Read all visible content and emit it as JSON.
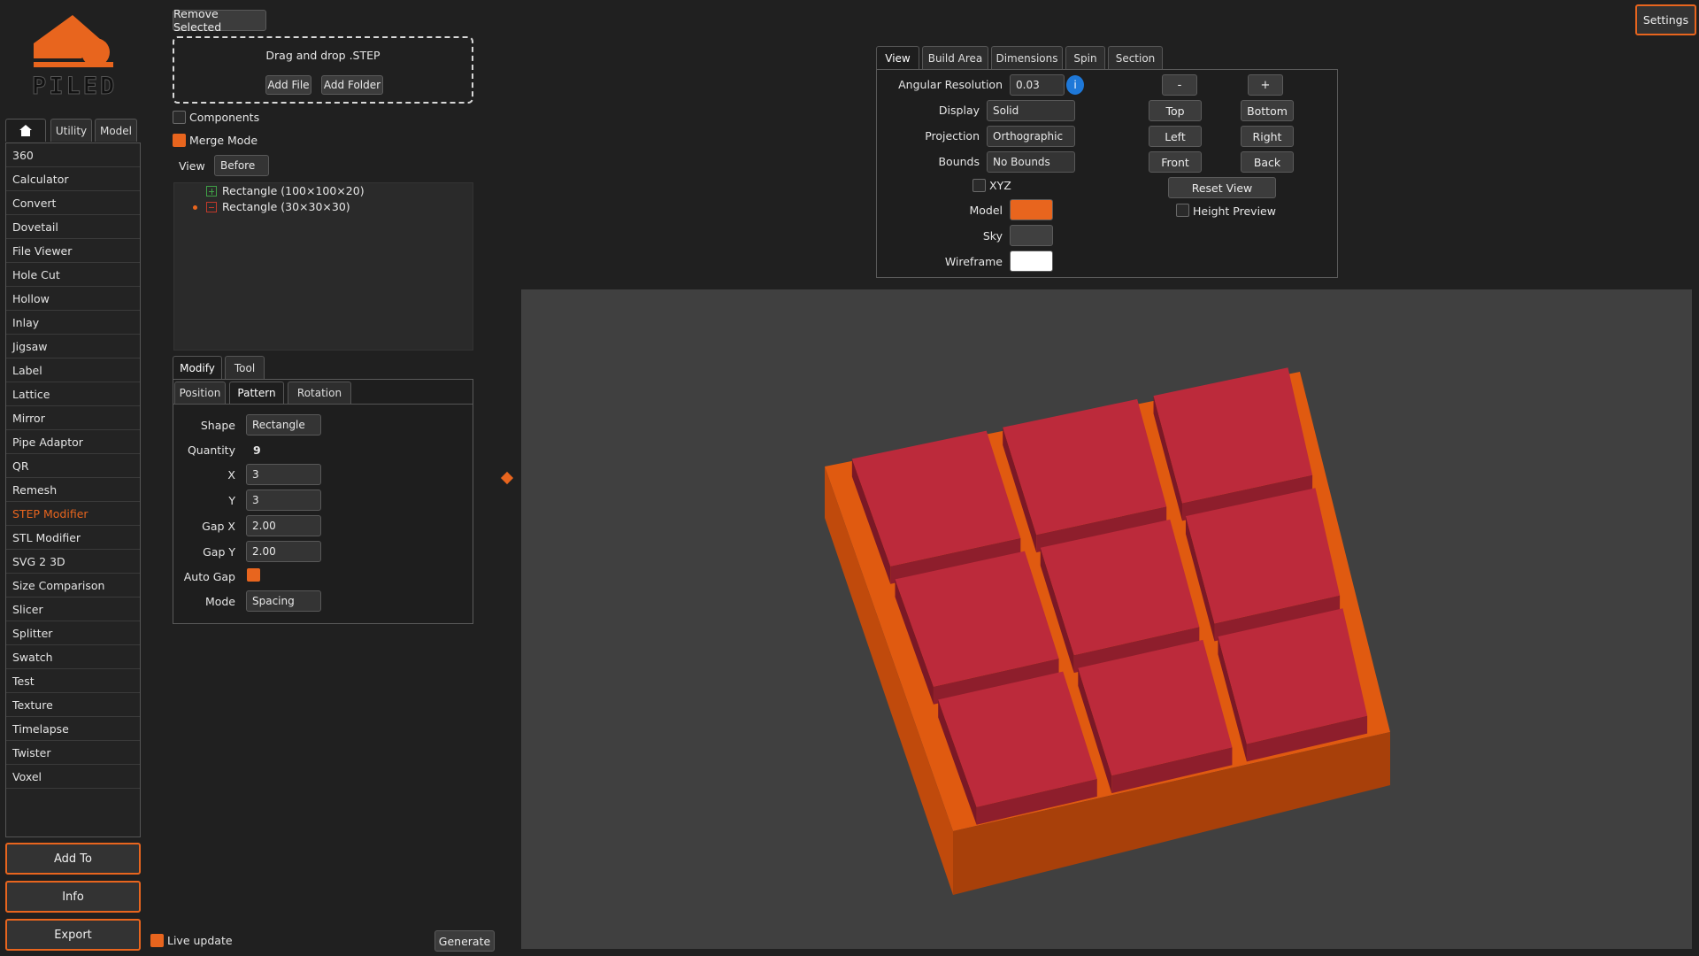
{
  "logo": {
    "text": "PILED"
  },
  "sidebar": {
    "tabs": [
      {
        "label": ""
      },
      {
        "label": "Utility"
      },
      {
        "label": "Model"
      }
    ],
    "items": [
      "360",
      "Calculator",
      "Convert",
      "Dovetail",
      "File Viewer",
      "Hole Cut",
      "Hollow",
      "Inlay",
      "Jigsaw",
      "Label",
      "Lattice",
      "Mirror",
      "Pipe Adaptor",
      "QR",
      "Remesh",
      "STEP Modifier",
      "STL Modifier",
      "SVG 2 3D",
      "Size Comparison",
      "Slicer",
      "Splitter",
      "Swatch",
      "Test",
      "Texture",
      "Timelapse",
      "Twister",
      "Voxel"
    ],
    "selected_item": "STEP Modifier",
    "buttons": {
      "add_to": "Add To",
      "info": "Info",
      "export": "Export"
    }
  },
  "files": {
    "remove_selected": "Remove Selected",
    "drop_text": "Drag and drop .STEP",
    "add_file": "Add File",
    "add_folder": "Add Folder",
    "components_label": "Components",
    "components_checked": false,
    "merge_mode_label": "Merge Mode",
    "merge_mode_checked": true,
    "view_label": "View",
    "view_value": "Before",
    "tree": [
      {
        "label": "Rectangle (100×100×20)",
        "kind": "add"
      },
      {
        "label": "Rectangle (30×30×30)",
        "kind": "subtract"
      }
    ]
  },
  "modify": {
    "tabs": [
      "Modify",
      "Tool"
    ],
    "subtabs": [
      "Position",
      "Pattern",
      "Rotation"
    ],
    "active_subtab": "Pattern",
    "shape_label": "Shape",
    "shape_value": "Rectangle",
    "quantity_label": "Quantity",
    "quantity_value": "9",
    "x_label": "X",
    "x_value": "3",
    "y_label": "Y",
    "y_value": "3",
    "gapx_label": "Gap X",
    "gapx_value": "2.00",
    "gapy_label": "Gap Y",
    "gapy_value": "2.00",
    "autogap_label": "Auto Gap",
    "autogap_checked": true,
    "mode_label": "Mode",
    "mode_value": "Spacing"
  },
  "footer": {
    "live_update_label": "Live update",
    "live_update_checked": true,
    "generate": "Generate"
  },
  "view_panel": {
    "tabs": [
      "View",
      "Build Area",
      "Dimensions",
      "Spin",
      "Section"
    ],
    "active_tab": "View",
    "angular_resolution_label": "Angular Resolution",
    "angular_resolution_value": "0.03",
    "info_glyph": "i",
    "display_label": "Display",
    "display_value": "Solid",
    "projection_label": "Projection",
    "projection_value": "Orthographic",
    "bounds_label": "Bounds",
    "bounds_value": "No Bounds",
    "xyz_label": "XYZ",
    "model_label": "Model",
    "sky_label": "Sky",
    "wireframe_label": "Wireframe",
    "minus": "-",
    "plus": "+",
    "top": "Top",
    "bottom": "Bottom",
    "left": "Left",
    "right": "Right",
    "front": "Front",
    "back": "Back",
    "reset_view": "Reset View",
    "height_preview_label": "Height Preview",
    "colors": {
      "model": "#e8651e",
      "sky": "#404040",
      "wireframe": "#ffffff"
    }
  },
  "settings": "Settings",
  "colors": {
    "accent": "#e8651e",
    "block": "#bc2a3b",
    "base": "#e05a10"
  }
}
